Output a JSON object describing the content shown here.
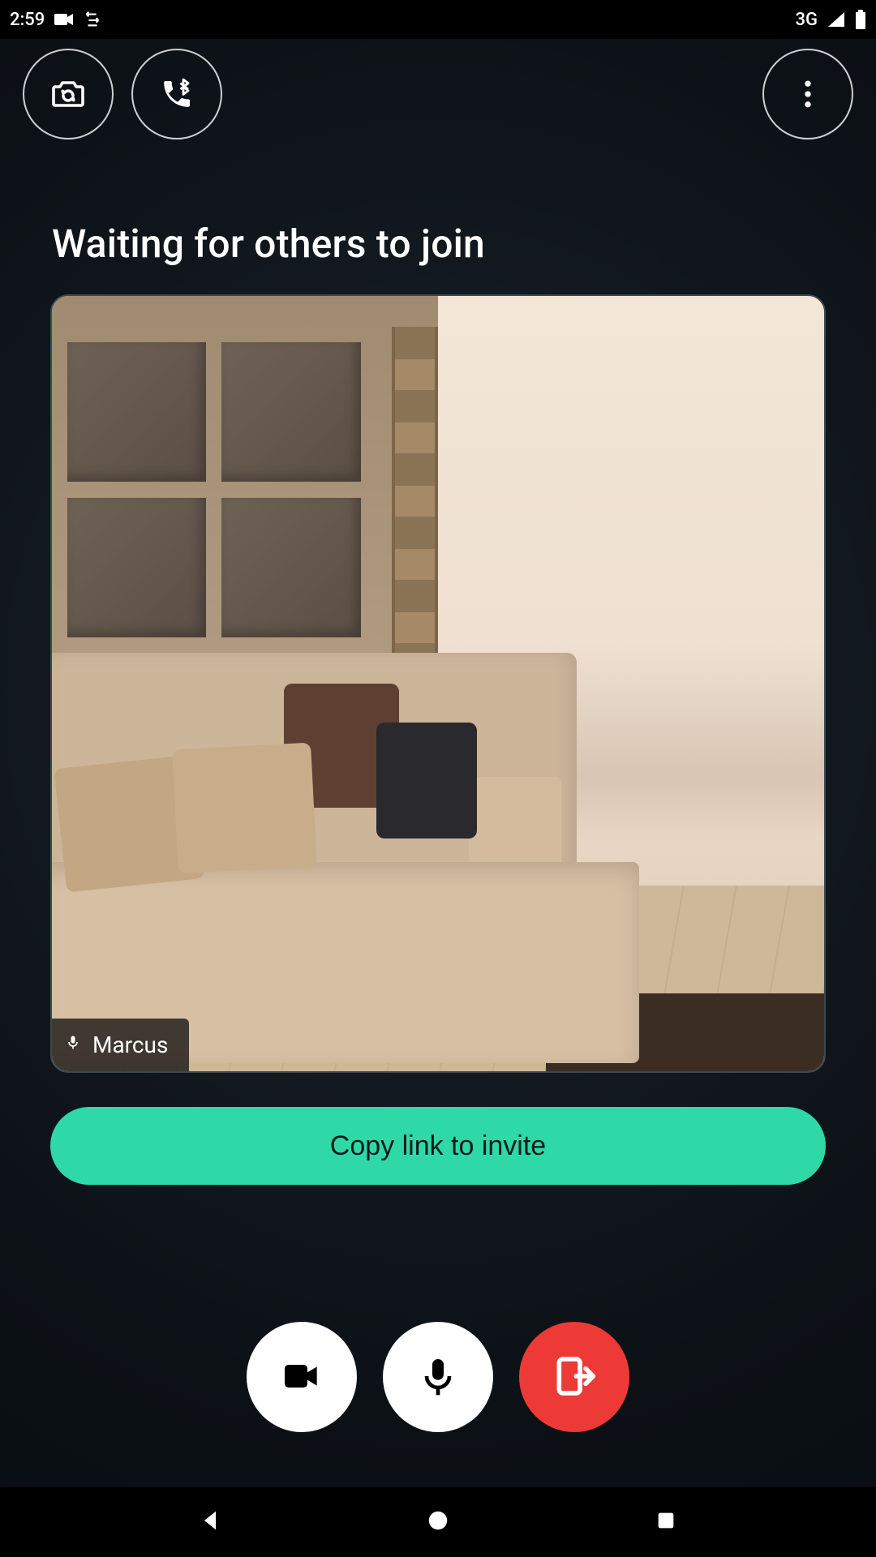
{
  "statusbar": {
    "time": "2:59",
    "network_label": "3G"
  },
  "heading": "Waiting for others to join",
  "participant": {
    "name": "Marcus"
  },
  "invite": {
    "button_label": "Copy link to invite"
  },
  "colors": {
    "accent": "#2ed9a7",
    "hangup": "#ee3a36"
  },
  "icons": {
    "status_camera": "camera-icon",
    "status_sync": "sync-icon",
    "status_signal": "signal-icon",
    "status_battery": "battery-icon",
    "flip_camera": "flip-camera-icon",
    "bluetooth_call": "bluetooth-call-icon",
    "overflow": "more-vert-icon",
    "mic_small": "mic-icon",
    "video": "videocam-icon",
    "mic": "mic-icon",
    "leave": "leave-icon",
    "nav_back": "back-icon",
    "nav_home": "home-icon",
    "nav_recent": "recent-icon"
  }
}
